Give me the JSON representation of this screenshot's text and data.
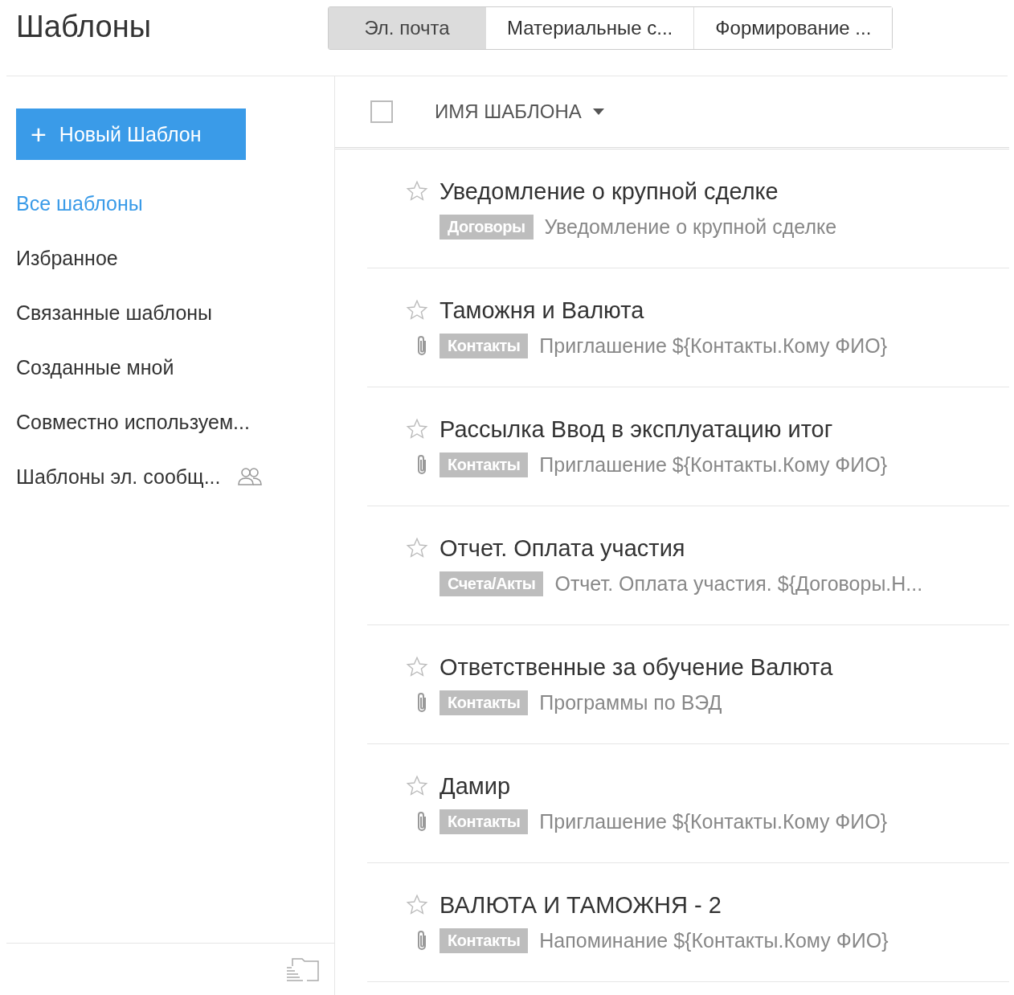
{
  "title": "Шаблоны",
  "tabs": [
    {
      "label": "Эл. почта",
      "selected": true
    },
    {
      "label": "Материальные с...",
      "selected": false
    },
    {
      "label": "Формирование ...",
      "selected": false
    }
  ],
  "new_button": {
    "icon": "+",
    "label": "Новый Шаблон"
  },
  "sidebar": {
    "items": [
      {
        "label": "Все шаблоны",
        "selected": true,
        "shared": false
      },
      {
        "label": "Избранное",
        "selected": false,
        "shared": false
      },
      {
        "label": "Связанные шаблоны",
        "selected": false,
        "shared": false
      },
      {
        "label": "Созданные мной",
        "selected": false,
        "shared": false
      },
      {
        "label": "Совместно используем...",
        "selected": false,
        "shared": false
      },
      {
        "label": "Шаблоны эл. сообщ...",
        "selected": false,
        "shared": true
      }
    ]
  },
  "table": {
    "all_checked": false,
    "column": "ИМЯ ШАБЛОНА",
    "rows": [
      {
        "favorite": false,
        "attachment": false,
        "name": "Уведомление о крупной сделке",
        "tag": "Договоры",
        "subject": "Уведомление о крупной сделке"
      },
      {
        "favorite": false,
        "attachment": true,
        "name": "Таможня и Валюта",
        "tag": "Контакты",
        "subject": "Приглашение ${Контакты.Кому ФИО}"
      },
      {
        "favorite": false,
        "attachment": true,
        "name": "Рассылка Ввод в эксплуатацию итог",
        "tag": "Контакты",
        "subject": "Приглашение ${Контакты.Кому ФИО}"
      },
      {
        "favorite": false,
        "attachment": false,
        "name": "Отчет. Оплата участия",
        "tag": "Счета/Акты",
        "subject": "Отчет. Оплата участия. ${Договоры.Н..."
      },
      {
        "favorite": false,
        "attachment": true,
        "name": "Ответственные за обучение Валюта",
        "tag": "Контакты",
        "subject": "Программы по ВЭД"
      },
      {
        "favorite": false,
        "attachment": true,
        "name": "Дамир",
        "tag": "Контакты",
        "subject": "Приглашение ${Контакты.Кому ФИО}"
      },
      {
        "favorite": false,
        "attachment": true,
        "name": "ВАЛЮТА И ТАМОЖНЯ - 2",
        "tag": "Контакты",
        "subject": "Напоминание ${Контакты.Кому ФИО}"
      }
    ]
  }
}
